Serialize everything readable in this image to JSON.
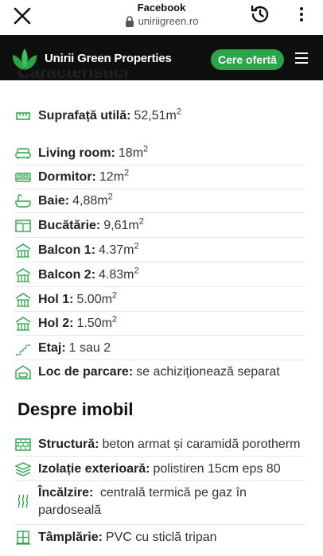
{
  "browser": {
    "app_title": "Facebook",
    "url": "uniriigreen.ro"
  },
  "header": {
    "brand": "Unirii Green Properties",
    "cta": "Cere ofertă"
  },
  "characteristics": {
    "title": "Caracteristici",
    "area": {
      "label": "Suprafață utilă:",
      "value": "52,51m",
      "unit_sup": "2"
    },
    "rooms": [
      {
        "label": "Living room:",
        "value": "18m",
        "sup": "2"
      },
      {
        "label": "Dormitor:",
        "value": "12m",
        "sup": "2"
      },
      {
        "label": "Baie:",
        "value": "4,88m",
        "sup": "2"
      },
      {
        "label": "Bucătărie:",
        "value": "9,61m",
        "sup": "2"
      },
      {
        "label": "Balcon 1:",
        "value": "4.37m",
        "sup": "2"
      },
      {
        "label": "Balcon 2:",
        "value": "4.83m",
        "sup": "2"
      },
      {
        "label": "Hol 1:",
        "value": "5.00m",
        "sup": "2"
      },
      {
        "label": "Hol 2:",
        "value": "1.50m",
        "sup": "2"
      },
      {
        "label": "Etaj:",
        "value": "1 sau 2",
        "sup": ""
      },
      {
        "label": "Loc de parcare:",
        "value": "se achiziționează separat",
        "sup": ""
      }
    ]
  },
  "building": {
    "title": "Despre imobil",
    "items": [
      {
        "label": "Structură:",
        "value": "beton armat și caramidă porotherm"
      },
      {
        "label": "Izolație exterioară:",
        "value": "polistiren 15cm eps 80"
      },
      {
        "label": "Încălzire:",
        "value": "centrală termică pe gaz în pardoseală"
      },
      {
        "label": "Tâmplărie:",
        "value": "PVC cu sticlă tripan"
      }
    ]
  },
  "colors": {
    "accent": "#2aa548",
    "header_bg": "#0f0f0f",
    "icon": "#2aa548"
  }
}
